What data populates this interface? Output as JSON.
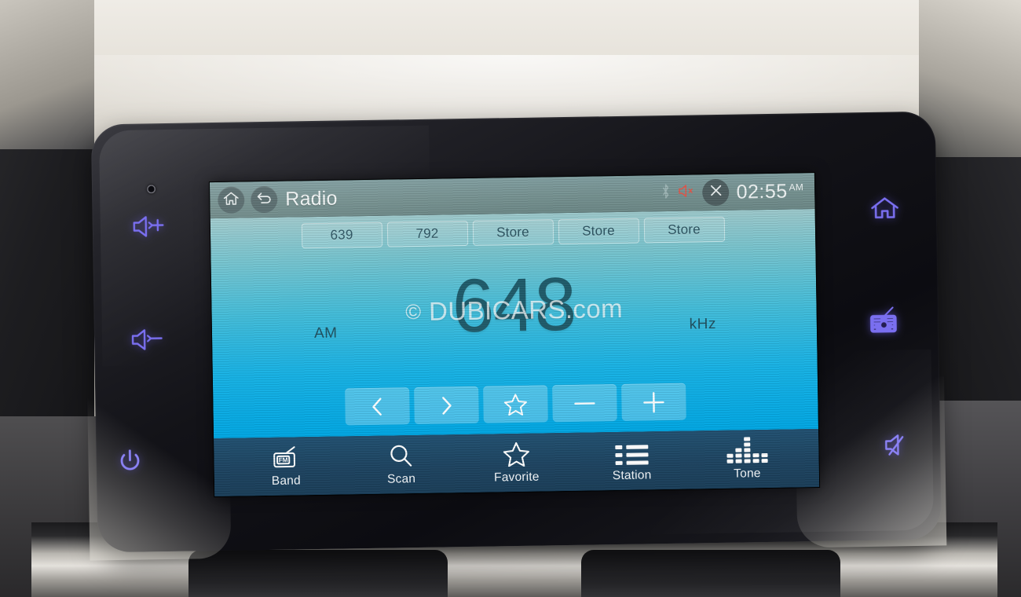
{
  "device": {
    "name": "car-infotainment-head-unit",
    "hardware_buttons": [
      {
        "name": "volume-up",
        "icon": "speaker-plus-icon"
      },
      {
        "name": "volume-down",
        "icon": "speaker-minus-icon"
      },
      {
        "name": "power",
        "icon": "power-icon"
      },
      {
        "name": "home",
        "icon": "home-icon"
      },
      {
        "name": "radio",
        "icon": "radio-icon"
      },
      {
        "name": "mute",
        "icon": "speaker-mute-icon"
      }
    ],
    "accent_color": "#7a6ff0"
  },
  "titlebar": {
    "home_icon": "home-icon",
    "back_icon": "back-arrow-icon",
    "title": "Radio",
    "bluetooth_icon": "bluetooth-icon",
    "mute_icon": "speaker-mute-icon",
    "close_icon": "close-x-icon",
    "time": "02:55",
    "meridiem": "AM"
  },
  "presets": [
    {
      "label": "639"
    },
    {
      "label": "792"
    },
    {
      "label": "Store"
    },
    {
      "label": "Store"
    },
    {
      "label": "Store"
    }
  ],
  "tuner": {
    "frequency": "648",
    "band": "AM",
    "unit": "kHz"
  },
  "watermark": {
    "copyright": "©",
    "text": "DUBICARS.com"
  },
  "controls": [
    {
      "name": "seek-previous",
      "icon": "chevron-left-icon"
    },
    {
      "name": "seek-next",
      "icon": "chevron-right-icon"
    },
    {
      "name": "favorite",
      "icon": "star-icon"
    },
    {
      "name": "tune-down",
      "icon": "minus-icon"
    },
    {
      "name": "tune-up",
      "icon": "plus-icon"
    }
  ],
  "navbar": [
    {
      "label": "Band",
      "icon": "fm-radio-icon"
    },
    {
      "label": "Scan",
      "icon": "search-icon"
    },
    {
      "label": "Favorite",
      "icon": "star-icon"
    },
    {
      "label": "Station",
      "icon": "list-icon"
    },
    {
      "label": "Tone",
      "icon": "equalizer-icon"
    }
  ],
  "colors": {
    "screen_top": "#9cc8cb",
    "screen_bottom": "#00a6e2",
    "navbar": "#1e4661",
    "titlebar": "#74908f",
    "frequency_text": "#1f5b6a"
  }
}
